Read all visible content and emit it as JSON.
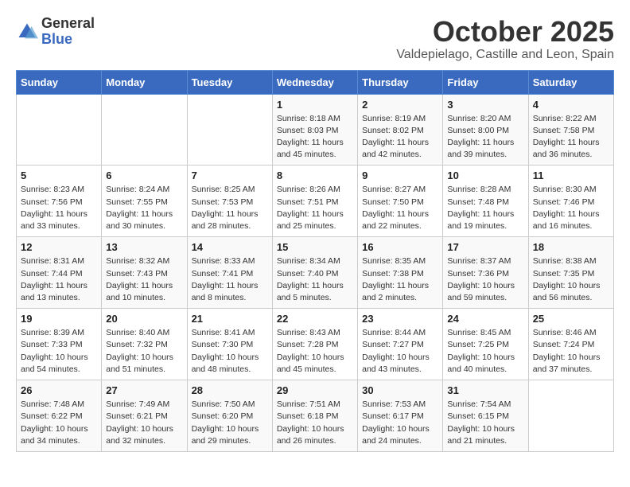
{
  "logo": {
    "general": "General",
    "blue": "Blue"
  },
  "header": {
    "month": "October 2025",
    "location": "Valdepielago, Castille and Leon, Spain"
  },
  "weekdays": [
    "Sunday",
    "Monday",
    "Tuesday",
    "Wednesday",
    "Thursday",
    "Friday",
    "Saturday"
  ],
  "weeks": [
    [
      {
        "day": "",
        "info": ""
      },
      {
        "day": "",
        "info": ""
      },
      {
        "day": "",
        "info": ""
      },
      {
        "day": "1",
        "info": "Sunrise: 8:18 AM\nSunset: 8:03 PM\nDaylight: 11 hours\nand 45 minutes."
      },
      {
        "day": "2",
        "info": "Sunrise: 8:19 AM\nSunset: 8:02 PM\nDaylight: 11 hours\nand 42 minutes."
      },
      {
        "day": "3",
        "info": "Sunrise: 8:20 AM\nSunset: 8:00 PM\nDaylight: 11 hours\nand 39 minutes."
      },
      {
        "day": "4",
        "info": "Sunrise: 8:22 AM\nSunset: 7:58 PM\nDaylight: 11 hours\nand 36 minutes."
      }
    ],
    [
      {
        "day": "5",
        "info": "Sunrise: 8:23 AM\nSunset: 7:56 PM\nDaylight: 11 hours\nand 33 minutes."
      },
      {
        "day": "6",
        "info": "Sunrise: 8:24 AM\nSunset: 7:55 PM\nDaylight: 11 hours\nand 30 minutes."
      },
      {
        "day": "7",
        "info": "Sunrise: 8:25 AM\nSunset: 7:53 PM\nDaylight: 11 hours\nand 28 minutes."
      },
      {
        "day": "8",
        "info": "Sunrise: 8:26 AM\nSunset: 7:51 PM\nDaylight: 11 hours\nand 25 minutes."
      },
      {
        "day": "9",
        "info": "Sunrise: 8:27 AM\nSunset: 7:50 PM\nDaylight: 11 hours\nand 22 minutes."
      },
      {
        "day": "10",
        "info": "Sunrise: 8:28 AM\nSunset: 7:48 PM\nDaylight: 11 hours\nand 19 minutes."
      },
      {
        "day": "11",
        "info": "Sunrise: 8:30 AM\nSunset: 7:46 PM\nDaylight: 11 hours\nand 16 minutes."
      }
    ],
    [
      {
        "day": "12",
        "info": "Sunrise: 8:31 AM\nSunset: 7:44 PM\nDaylight: 11 hours\nand 13 minutes."
      },
      {
        "day": "13",
        "info": "Sunrise: 8:32 AM\nSunset: 7:43 PM\nDaylight: 11 hours\nand 10 minutes."
      },
      {
        "day": "14",
        "info": "Sunrise: 8:33 AM\nSunset: 7:41 PM\nDaylight: 11 hours\nand 8 minutes."
      },
      {
        "day": "15",
        "info": "Sunrise: 8:34 AM\nSunset: 7:40 PM\nDaylight: 11 hours\nand 5 minutes."
      },
      {
        "day": "16",
        "info": "Sunrise: 8:35 AM\nSunset: 7:38 PM\nDaylight: 11 hours\nand 2 minutes."
      },
      {
        "day": "17",
        "info": "Sunrise: 8:37 AM\nSunset: 7:36 PM\nDaylight: 10 hours\nand 59 minutes."
      },
      {
        "day": "18",
        "info": "Sunrise: 8:38 AM\nSunset: 7:35 PM\nDaylight: 10 hours\nand 56 minutes."
      }
    ],
    [
      {
        "day": "19",
        "info": "Sunrise: 8:39 AM\nSunset: 7:33 PM\nDaylight: 10 hours\nand 54 minutes."
      },
      {
        "day": "20",
        "info": "Sunrise: 8:40 AM\nSunset: 7:32 PM\nDaylight: 10 hours\nand 51 minutes."
      },
      {
        "day": "21",
        "info": "Sunrise: 8:41 AM\nSunset: 7:30 PM\nDaylight: 10 hours\nand 48 minutes."
      },
      {
        "day": "22",
        "info": "Sunrise: 8:43 AM\nSunset: 7:28 PM\nDaylight: 10 hours\nand 45 minutes."
      },
      {
        "day": "23",
        "info": "Sunrise: 8:44 AM\nSunset: 7:27 PM\nDaylight: 10 hours\nand 43 minutes."
      },
      {
        "day": "24",
        "info": "Sunrise: 8:45 AM\nSunset: 7:25 PM\nDaylight: 10 hours\nand 40 minutes."
      },
      {
        "day": "25",
        "info": "Sunrise: 8:46 AM\nSunset: 7:24 PM\nDaylight: 10 hours\nand 37 minutes."
      }
    ],
    [
      {
        "day": "26",
        "info": "Sunrise: 7:48 AM\nSunset: 6:22 PM\nDaylight: 10 hours\nand 34 minutes."
      },
      {
        "day": "27",
        "info": "Sunrise: 7:49 AM\nSunset: 6:21 PM\nDaylight: 10 hours\nand 32 minutes."
      },
      {
        "day": "28",
        "info": "Sunrise: 7:50 AM\nSunset: 6:20 PM\nDaylight: 10 hours\nand 29 minutes."
      },
      {
        "day": "29",
        "info": "Sunrise: 7:51 AM\nSunset: 6:18 PM\nDaylight: 10 hours\nand 26 minutes."
      },
      {
        "day": "30",
        "info": "Sunrise: 7:53 AM\nSunset: 6:17 PM\nDaylight: 10 hours\nand 24 minutes."
      },
      {
        "day": "31",
        "info": "Sunrise: 7:54 AM\nSunset: 6:15 PM\nDaylight: 10 hours\nand 21 minutes."
      },
      {
        "day": "",
        "info": ""
      }
    ]
  ]
}
